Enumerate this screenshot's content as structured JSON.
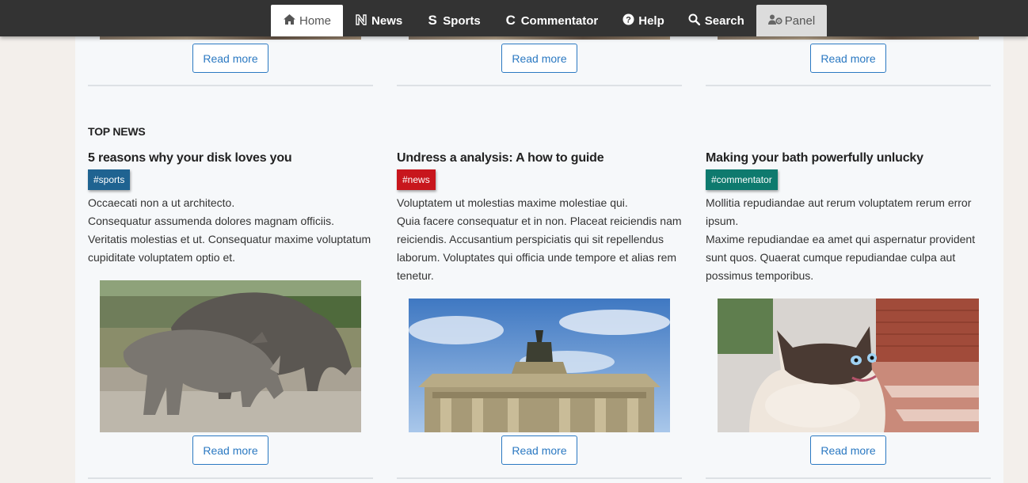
{
  "nav": {
    "items": [
      {
        "label": "Home",
        "icon": "home-icon"
      },
      {
        "label": "News",
        "icon": "news-icon"
      },
      {
        "label": "Sports",
        "icon": "sports-icon"
      },
      {
        "label": "Commentator",
        "icon": "commentator-icon"
      },
      {
        "label": "Help",
        "icon": "help-icon"
      },
      {
        "label": "Search",
        "icon": "search-icon"
      },
      {
        "label": "Panel",
        "icon": "users-cog-icon"
      }
    ]
  },
  "top_row": {
    "read_more_label": "Read more"
  },
  "section": {
    "title": "TOP NEWS"
  },
  "articles": [
    {
      "title": "5 reasons why your disk loves you",
      "tag": "#sports",
      "tag_color": "#1f6391",
      "excerpt": [
        "Occaecati non a ut architecto.",
        "Consequatur assumenda dolores magnam officiis. Veritatis molestias et ut. Consequatur maxime voluptatum cupiditate voluptatem optio et."
      ],
      "image": "rhinoceros-photo",
      "read_more_label": "Read more"
    },
    {
      "title": "Undress a analysis: A how to guide",
      "tag": "#news",
      "tag_color": "#c8161d",
      "excerpt": [
        "Voluptatem ut molestias maxime molestiae qui.",
        "Quia facere consequatur et in non. Placeat reiciendis nam reiciendis. Accusantium perspiciatis qui sit repellendus laborum. Voluptates qui officia unde tempore et alias rem tenetur."
      ],
      "image": "brandenburg-gate-photo",
      "read_more_label": "Read more"
    },
    {
      "title": "Making your bath powerfully unlucky",
      "tag": "#commentator",
      "tag_color": "#0e7a6e",
      "excerpt": [
        "Mollitia repudiandae aut rerum voluptatem rerum error ipsum.",
        "Maxime repudiandae ea amet qui aspernatur provident sunt quos. Quaerat cumque repudiandae culpa aut possimus temporibus."
      ],
      "image": "siamese-cat-photo",
      "read_more_label": "Read more"
    }
  ]
}
